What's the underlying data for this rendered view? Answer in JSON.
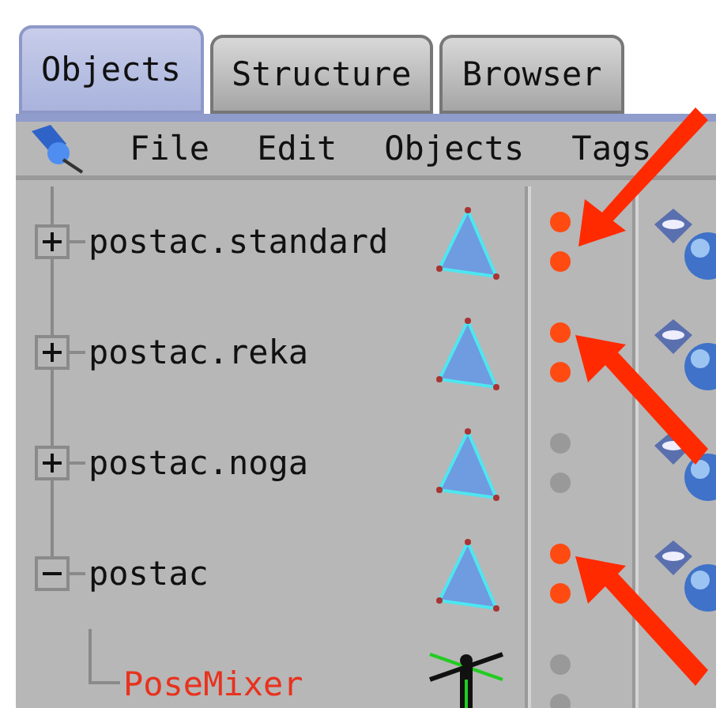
{
  "tabs": [
    {
      "label": "Objects",
      "selected": true
    },
    {
      "label": "Structure",
      "selected": false
    },
    {
      "label": "Browser",
      "selected": false
    }
  ],
  "menu": [
    "File",
    "Edit",
    "Objects",
    "Tags"
  ],
  "objects": [
    {
      "name": "postac.standard",
      "kind": "polygon",
      "expanded": false,
      "editor_visible": true,
      "render_visible": true,
      "tag": true,
      "arrow_from_above": true,
      "arrow_from_below": false
    },
    {
      "name": "postac.reka",
      "kind": "polygon",
      "expanded": false,
      "editor_visible": true,
      "render_visible": true,
      "tag": true,
      "arrow_from_above": false,
      "arrow_from_below": true
    },
    {
      "name": "postac.noga",
      "kind": "polygon",
      "expanded": false,
      "editor_visible": false,
      "render_visible": false,
      "tag": true,
      "arrow_from_above": false,
      "arrow_from_below": false
    },
    {
      "name": "postac",
      "kind": "polygon",
      "expanded": true,
      "editor_visible": true,
      "render_visible": true,
      "tag": true,
      "arrow_from_above": false,
      "arrow_from_below": true,
      "children": [
        {
          "name": "PoseMixer",
          "kind": "figure",
          "color": "#e8321e",
          "editor_visible": false,
          "render_visible": false,
          "tag": false,
          "arrow_from_above": false,
          "arrow_from_below": false
        }
      ]
    }
  ]
}
